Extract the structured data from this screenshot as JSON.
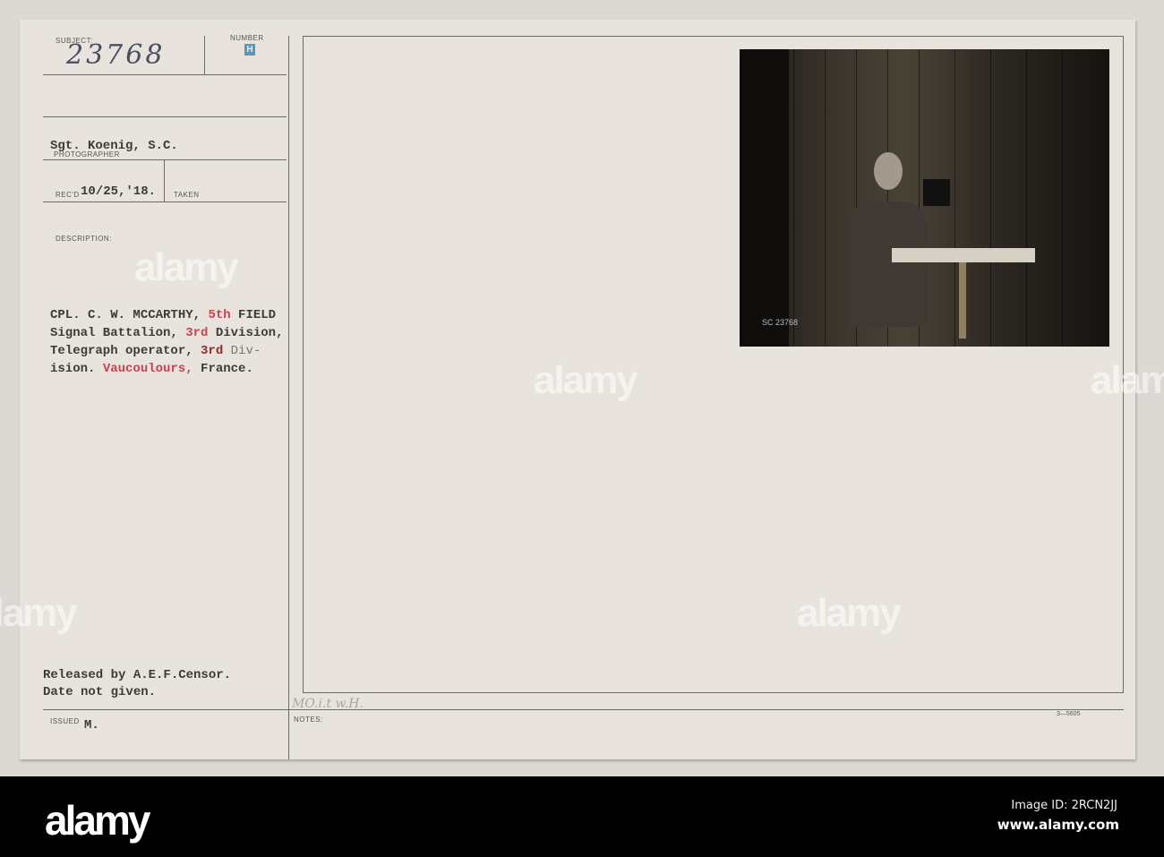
{
  "card": {
    "subject_label": "SUBJECT:",
    "subject_number": "23768",
    "number_label": "NUMBER",
    "number_stamp": "H",
    "photographer": "Sgt. Koenig, S.C.",
    "photographer_label": "PHOTOGRAPHER",
    "recd_label": "REC'D",
    "recd_date": "10/25,'18.",
    "taken_label": "TAKEN",
    "description_label": "DESCRIPTION:",
    "description": {
      "l1a": "CPL. C. W. MCCARTHY, ",
      "l1b": "5th",
      "l1c": " FIELD",
      "l2a": "Signal Battalion, ",
      "l2b": "3rd",
      "l2c": " Division,",
      "l3a": "Telegraph operator, ",
      "l3b": "3rd",
      "l3c": " Div-",
      "l4a": "ision. ",
      "l4b": "Vaucoulours,",
      "l4c": " France."
    },
    "release_1": "Released by A.E.F.Censor.",
    "release_2": "Date not given.",
    "issued_label": "ISSUED",
    "issued_value": "M.",
    "notes_label": "NOTES:",
    "notes_handwritten": "MO.i.t w.H.",
    "form_number": "3—5605",
    "photo_number": "SC 23768"
  },
  "watermark": "alamy",
  "banner": {
    "logo": "alamy",
    "image_id": "Image ID: 2RCN2JJ",
    "site": "www.alamy.com"
  },
  "colors": {
    "accent_red": "#c8424f",
    "ink": "#3d3a37",
    "card": "#e8e4dd"
  }
}
